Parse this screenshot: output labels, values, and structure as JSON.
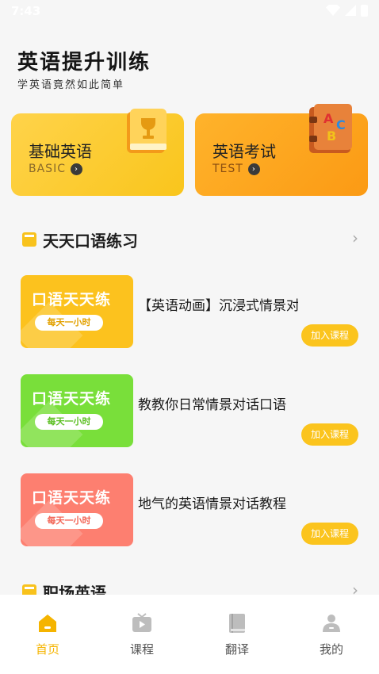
{
  "status_bar": {
    "time": "7:43"
  },
  "header": {
    "title": "英语提升训练",
    "subtitle": "学英语竟然如此简单"
  },
  "categories": [
    {
      "title": "基础英语",
      "sub": "BASIC"
    },
    {
      "title": "英语考试",
      "sub": "TEST"
    }
  ],
  "sections": {
    "daily": {
      "title": "天天口语练习",
      "more": "›"
    },
    "work": {
      "title": "职场英语",
      "more": "›"
    }
  },
  "courses": [
    {
      "thumb_title": "口语天天练",
      "thumb_pill": "每天一小时",
      "name": "【英语动画】沉浸式情景对",
      "join": "加入课程"
    },
    {
      "thumb_title": "口语天天练",
      "thumb_pill": "每天一小时",
      "name": "教教你日常情景对话口语",
      "join": "加入课程"
    },
    {
      "thumb_title": "口语天天练",
      "thumb_pill": "每天一小时",
      "name": "地气的英语情景对话教程",
      "join": "加入课程"
    }
  ],
  "tabs": [
    {
      "label": "首页",
      "icon": "home-icon"
    },
    {
      "label": "课程",
      "icon": "tv-icon"
    },
    {
      "label": "翻译",
      "icon": "book-icon"
    },
    {
      "label": "我的",
      "icon": "person-icon"
    }
  ],
  "colors": {
    "accent": "#f5b400",
    "yellow": "#fcc21e",
    "green": "#79df3a",
    "red": "#fd7f70"
  }
}
